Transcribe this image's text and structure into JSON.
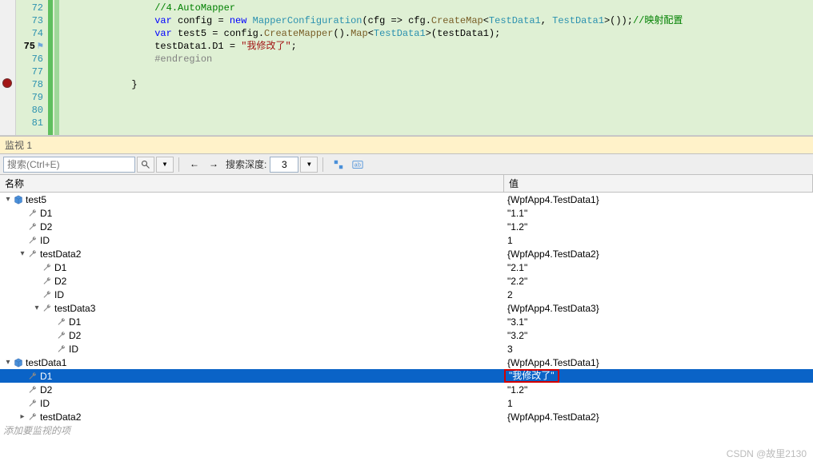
{
  "editor": {
    "breakpoint_line": 78,
    "current_line": 75,
    "lines": [
      {
        "n": 72,
        "seg": [
          {
            "c": "c-gn",
            "t": "                //4.AutoMapper"
          }
        ]
      },
      {
        "n": 73,
        "seg": [
          {
            "c": "",
            "t": "                "
          },
          {
            "c": "c-kw",
            "t": "var"
          },
          {
            "c": "",
            "t": " config = "
          },
          {
            "c": "c-kw",
            "t": "new"
          },
          {
            "c": "",
            "t": " "
          },
          {
            "c": "c-tp",
            "t": "MapperConfiguration"
          },
          {
            "c": "",
            "t": "(cfg => cfg."
          },
          {
            "c": "c-mt",
            "t": "CreateMap"
          },
          {
            "c": "",
            "t": "<"
          },
          {
            "c": "c-tp",
            "t": "TestData1"
          },
          {
            "c": "",
            "t": ", "
          },
          {
            "c": "c-tp",
            "t": "TestData1"
          },
          {
            "c": "",
            "t": ">());"
          },
          {
            "c": "c-gn",
            "t": "//映射配置"
          }
        ]
      },
      {
        "n": 74,
        "seg": [
          {
            "c": "",
            "t": "                "
          },
          {
            "c": "c-kw",
            "t": "var"
          },
          {
            "c": "",
            "t": " test5 = config."
          },
          {
            "c": "c-mt",
            "t": "CreateMapper"
          },
          {
            "c": "",
            "t": "()."
          },
          {
            "c": "c-mt",
            "t": "Map"
          },
          {
            "c": "",
            "t": "<"
          },
          {
            "c": "c-tp",
            "t": "TestData1"
          },
          {
            "c": "",
            "t": ">(testData1);"
          }
        ]
      },
      {
        "n": 75,
        "cur": true,
        "seg": [
          {
            "c": "",
            "t": "                testData1.D1 = "
          },
          {
            "c": "c-st",
            "t": "\"我修改了\""
          },
          {
            "c": "",
            "t": ";"
          }
        ]
      },
      {
        "n": 76,
        "seg": [
          {
            "c": "c-gr",
            "t": "                #endregion"
          }
        ]
      },
      {
        "n": 77,
        "seg": [
          {
            "c": "",
            "t": ""
          }
        ]
      },
      {
        "n": 78,
        "seg": [
          {
            "c": "",
            "t": "            }"
          }
        ]
      },
      {
        "n": 79,
        "seg": [
          {
            "c": "",
            "t": ""
          }
        ]
      },
      {
        "n": 80,
        "seg": [
          {
            "c": "",
            "t": ""
          }
        ]
      },
      {
        "n": 81,
        "seg": [
          {
            "c": "",
            "t": ""
          }
        ]
      }
    ]
  },
  "watch": {
    "panel_title": "监视 1",
    "search_placeholder": "搜索(Ctrl+E)",
    "nav_label": "搜索深度:",
    "depth_value": "3",
    "col_name": "名称",
    "col_value": "值",
    "placeholder": "添加要监视的项",
    "rows": [
      {
        "ind": 0,
        "exp": "▾",
        "ico": "cube",
        "name": "test5",
        "val": "{WpfApp4.TestData1}"
      },
      {
        "ind": 1,
        "exp": " ",
        "ico": "wrench",
        "name": "D1",
        "val": "\"1.1\""
      },
      {
        "ind": 1,
        "exp": " ",
        "ico": "wrench",
        "name": "D2",
        "val": "\"1.2\""
      },
      {
        "ind": 1,
        "exp": " ",
        "ico": "wrench",
        "name": "ID",
        "val": "1"
      },
      {
        "ind": 1,
        "exp": "▾",
        "ico": "wrench",
        "name": "testData2",
        "val": "{WpfApp4.TestData2}"
      },
      {
        "ind": 2,
        "exp": " ",
        "ico": "wrench",
        "name": "D1",
        "val": "\"2.1\""
      },
      {
        "ind": 2,
        "exp": " ",
        "ico": "wrench",
        "name": "D2",
        "val": "\"2.2\""
      },
      {
        "ind": 2,
        "exp": " ",
        "ico": "wrench",
        "name": "ID",
        "val": "2"
      },
      {
        "ind": 2,
        "exp": "▾",
        "ico": "wrench",
        "name": "testData3",
        "val": "{WpfApp4.TestData3}"
      },
      {
        "ind": 3,
        "exp": " ",
        "ico": "wrench",
        "name": "D1",
        "val": "\"3.1\""
      },
      {
        "ind": 3,
        "exp": " ",
        "ico": "wrench",
        "name": "D2",
        "val": "\"3.2\""
      },
      {
        "ind": 3,
        "exp": " ",
        "ico": "wrench",
        "name": "ID",
        "val": "3"
      },
      {
        "ind": 0,
        "exp": "▾",
        "ico": "cube",
        "name": "testData1",
        "val": "{WpfApp4.TestData1}"
      },
      {
        "ind": 1,
        "exp": " ",
        "ico": "wrench",
        "name": "D1",
        "val": "\"我修改了\"",
        "sel": true,
        "hi": true
      },
      {
        "ind": 1,
        "exp": " ",
        "ico": "wrench",
        "name": "D2",
        "val": "\"1.2\""
      },
      {
        "ind": 1,
        "exp": " ",
        "ico": "wrench",
        "name": "ID",
        "val": "1"
      },
      {
        "ind": 1,
        "exp": "▸",
        "ico": "wrench",
        "name": "testData2",
        "val": "{WpfApp4.TestData2}"
      }
    ]
  },
  "watermark": "CSDN @故里2130"
}
